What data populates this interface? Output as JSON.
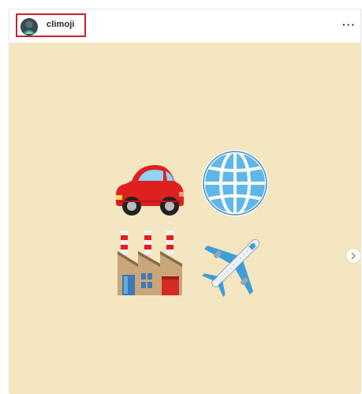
{
  "post": {
    "username": "climoji",
    "more_icon": "more-options-icon",
    "image_bg": "#f5e6c2",
    "emojis": [
      "car-emoji",
      "globe-emoji",
      "factory-emoji",
      "airplane-emoji"
    ],
    "next_icon": "chevron-right-icon",
    "highlight_color": "#c4252b"
  }
}
